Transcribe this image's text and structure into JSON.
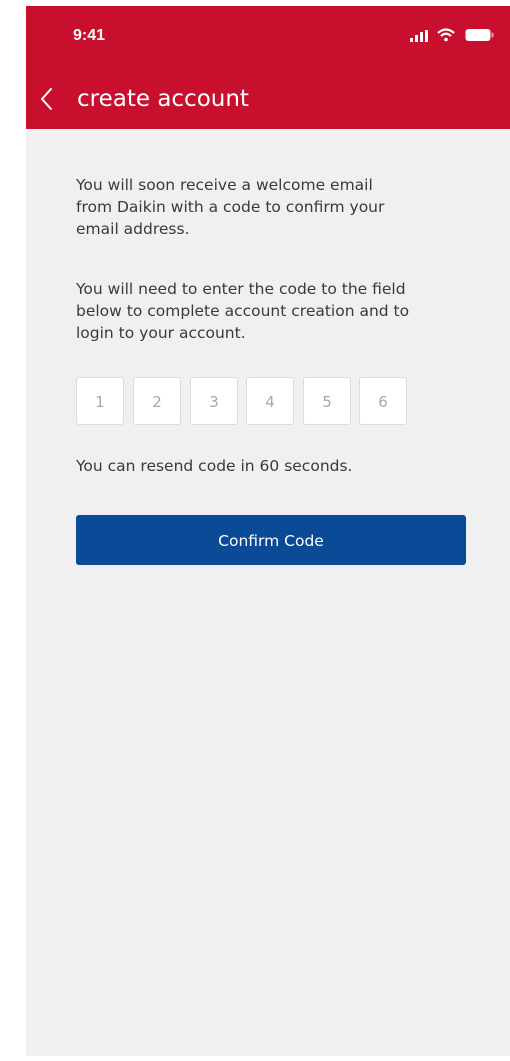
{
  "status_bar": {
    "time": "9:41",
    "icons": [
      "signal-icon",
      "wifi-icon",
      "battery-icon"
    ]
  },
  "header": {
    "back_icon": "chevron-left-icon",
    "title": "create account"
  },
  "content": {
    "paragraph_1": "You will soon receive a welcome  email\nfrom Daikin with a code to confirm your\nemail address.",
    "paragraph_2": "You will need to enter the code to the field\nbelow to complete account creation and to\nlogin to your account.",
    "code_placeholders": [
      "1",
      "2",
      "3",
      "4",
      "5",
      "6"
    ],
    "resend_text": "You can resend code in 60 seconds.",
    "confirm_button_label": "Confirm Code"
  },
  "colors": {
    "brand_red": "#c8102e",
    "primary_blue": "#0a4a96",
    "background": "#f0f0f0"
  }
}
